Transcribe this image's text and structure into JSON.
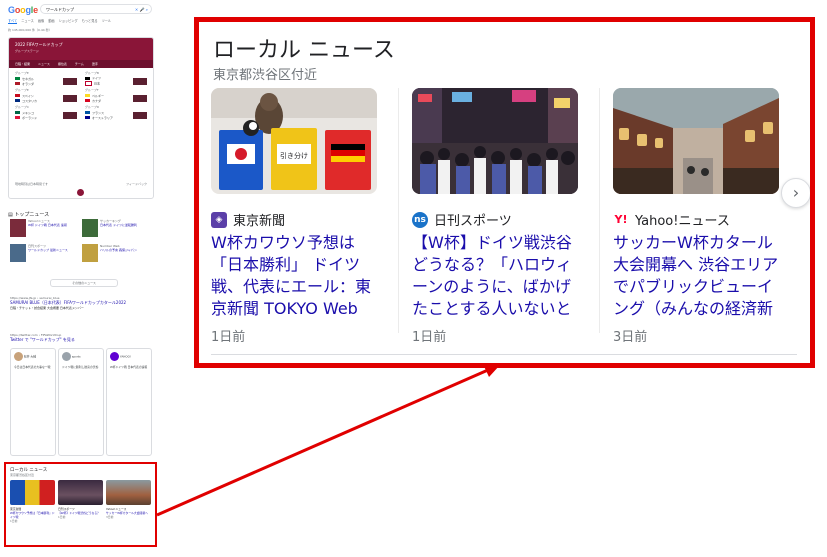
{
  "mini_serp": {
    "logo_letters": [
      "G",
      "o",
      "o",
      "g",
      "l",
      "e"
    ],
    "query": "ワールドカップ",
    "tabs": [
      "すべて",
      "ニュース",
      "画像",
      "動画",
      "ショッピング",
      "もっと見る",
      "ツール"
    ],
    "active_tab": "すべて",
    "result_count": "約 145,000,000 件（0.44 秒）",
    "wc_title": "2022 FIFAワールドカップ",
    "wc_subtitle": "グループステージ",
    "wc_tabs": [
      "日程・結果",
      "ニュース",
      "順位表",
      "チーム",
      "選手"
    ],
    "groups": [
      {
        "name": "グループE",
        "matches": [
          "セネガル",
          "オランダ"
        ]
      },
      {
        "name": "グループB",
        "matches": [
          "ドイツ",
          "日本"
        ]
      },
      {
        "name": "グループE",
        "matches": [
          "スペイン",
          "コスタリカ"
        ]
      },
      {
        "name": "グループF",
        "matches": [
          "ベルギー",
          "カナダ"
        ]
      },
      {
        "name": "グループC",
        "matches": [
          "メキシコ",
          "ポーランド"
        ]
      },
      {
        "name": "グループD",
        "matches": [
          "フランス",
          "オーストラリア"
        ]
      }
    ],
    "wc_footer_left": "現地時刻は日本時間です",
    "wc_footer_right": "フィードバック",
    "top_stories_title": "トップニュース",
    "top_stories": [
      {
        "source": "Yahoo!ニュース",
        "headline": "W杯 ドイツ戦 日本代表 速報"
      },
      {
        "source": "サッカーキング",
        "headline": "日本代表 ドイツに逆転勝利"
      },
      {
        "source": "日刊スポーツ",
        "headline": "ワールドカップ 最新ニュース"
      },
      {
        "source": "Number Web",
        "headline": "ハリルの予言 森保ジャパン"
      }
    ],
    "more_news": "その他のニュース",
    "results": [
      {
        "url": "https://www.jfa.jp › samurai_blue",
        "title": "SAMURAI BLUE（日本代表）FIFAワールドカップカタール2022",
        "snippet": "日程・チケット・試合結果 大会概要 日本代表メンバー"
      },
      {
        "url": "https://twitter.com › FIFAWorldCup",
        "title": "Twitter で \"ワールドカップ\" を見る",
        "snippet": ""
      }
    ],
    "tweets": [
      {
        "name": "松井 大輔",
        "text": "今日は日本代表の大事な一戦"
      },
      {
        "name": "sports",
        "text": "ドイツ戦に勝利し歓喜の渋谷"
      },
      {
        "name": "YAHOO!",
        "text": "W杯ドイツ戦 日本代表の速報"
      }
    ],
    "local_title": "ローカル ニュース",
    "local_location": "東京都渋谷区付近",
    "local_cards": [
      {
        "source": "東京新聞",
        "headline": "W杯カワウソ予想は「日本勝利」ドイツ戦",
        "time": "1日前"
      },
      {
        "source": "日刊スポーツ",
        "headline": "【W杯】ドイツ戦渋谷どうなる？",
        "time": "1日前"
      },
      {
        "source": "Yahoo!ニュース",
        "headline": "サッカーW杯カタール大会開幕へ",
        "time": "3日前"
      }
    ]
  },
  "local_news": {
    "title": "ローカル ニュース",
    "location": "東京都渋谷区付近",
    "next_icon": "chevron-right-icon",
    "cards": [
      {
        "source": "東京新聞",
        "source_icon": "tokyo-shimbun-icon",
        "source_color": "#5b3fa8",
        "headline": "W杯カワウソ予想は「日本勝利」 ドイツ戦、代表にエール：東京新聞 TOKYO Web",
        "time": "1日前",
        "image": "otter-with-flag-cups"
      },
      {
        "source": "日刊スポーツ",
        "source_icon": "nikkan-sports-icon",
        "source_color": "#1a73c9",
        "headline": "【W杯】ドイツ戦渋谷どうなる？「ハロウィーンのように、ばかげたことする人いないと信じて…",
        "time": "1日前",
        "image": "shibuya-crowd-night"
      },
      {
        "source": "Yahoo!ニュース",
        "source_icon": "yahoo-icon",
        "source_color": "#ff0033",
        "headline": "サッカーW杯カタール大会開幕へ 渋谷エリアでパブリックビューイング（みんなの経済新聞ネ…",
        "time": "3日前",
        "image": "street-restaurants"
      }
    ]
  },
  "colors": {
    "highlight": "#e00000",
    "link": "#1a0dab",
    "wc_brand": "#8a1538"
  }
}
